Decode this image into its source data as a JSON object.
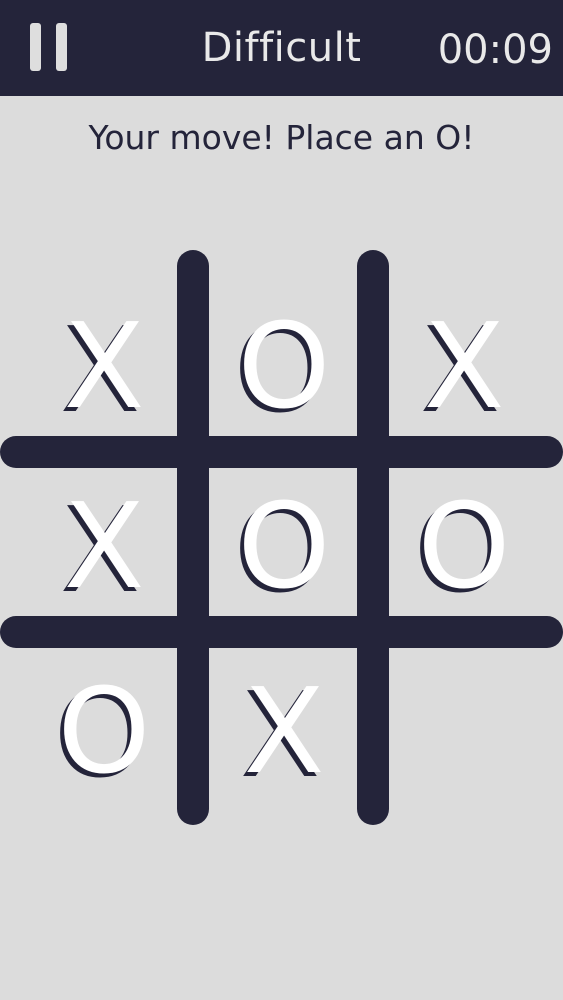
{
  "header": {
    "title": "Difficult",
    "timer": "00:09"
  },
  "status_message": "Your move! Place an O!",
  "board": {
    "cells": [
      [
        "X",
        "O",
        "X"
      ],
      [
        "X",
        "O",
        "O"
      ],
      [
        "O",
        "X",
        ""
      ]
    ]
  },
  "colors": {
    "topbar": "#24243a",
    "background": "#dcdcdc",
    "grid": "#24243a",
    "mark": "#ffffff"
  }
}
